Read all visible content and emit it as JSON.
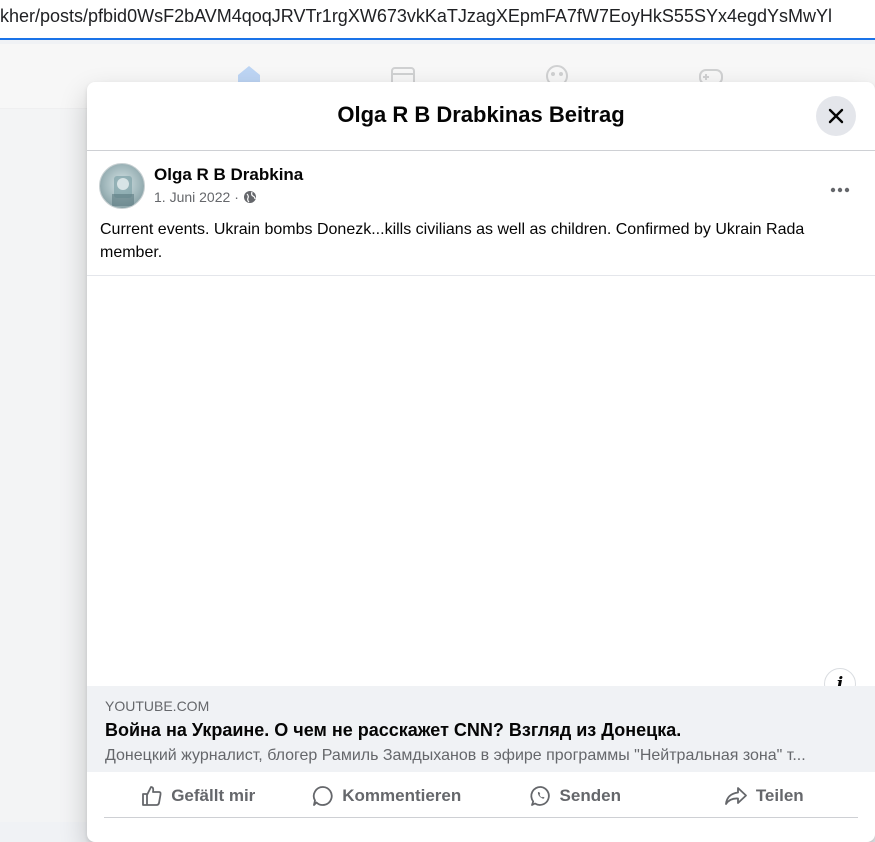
{
  "browser": {
    "url": "kher/posts/pfbid0WsF2bAVM4qoqJRVTr1rgXW673vkKaTJzagXEpmFA7fW7EoyHkS55SYx4egdYsMwYl"
  },
  "modal": {
    "title": "Olga R B Drabkinas Beitrag"
  },
  "post": {
    "author": "Olga R B Drabkina",
    "date": "1. Juni 2022",
    "separator": "·",
    "text": "Current events. Ukrain bombs  Donezk...kills civilians as well as children. Confirmed by Ukrain Rada member."
  },
  "link_preview": {
    "domain": "YOUTUBE.COM",
    "title": "Война на Украине. О чем не расскажет CNN? Взгляд из Донецка.",
    "description": "Донецкий журналист, блогер Рамиль Замдыханов в эфире программы \"Нейтральная зона\" т..."
  },
  "actions": {
    "like": "Gefällt mir",
    "comment": "Kommentieren",
    "send": "Senden",
    "share": "Teilen"
  },
  "icons": {
    "close": "close-icon",
    "more": "more-horizontal-icon",
    "audience": "globe-icon",
    "info": "info-icon",
    "like": "thumbs-up-icon",
    "comment": "comment-icon",
    "send": "whatsapp-icon",
    "share": "share-arrow-icon"
  },
  "colors": {
    "brand": "#1877f2",
    "secondary_text": "#65676b",
    "link_bg": "#f0f2f5"
  }
}
